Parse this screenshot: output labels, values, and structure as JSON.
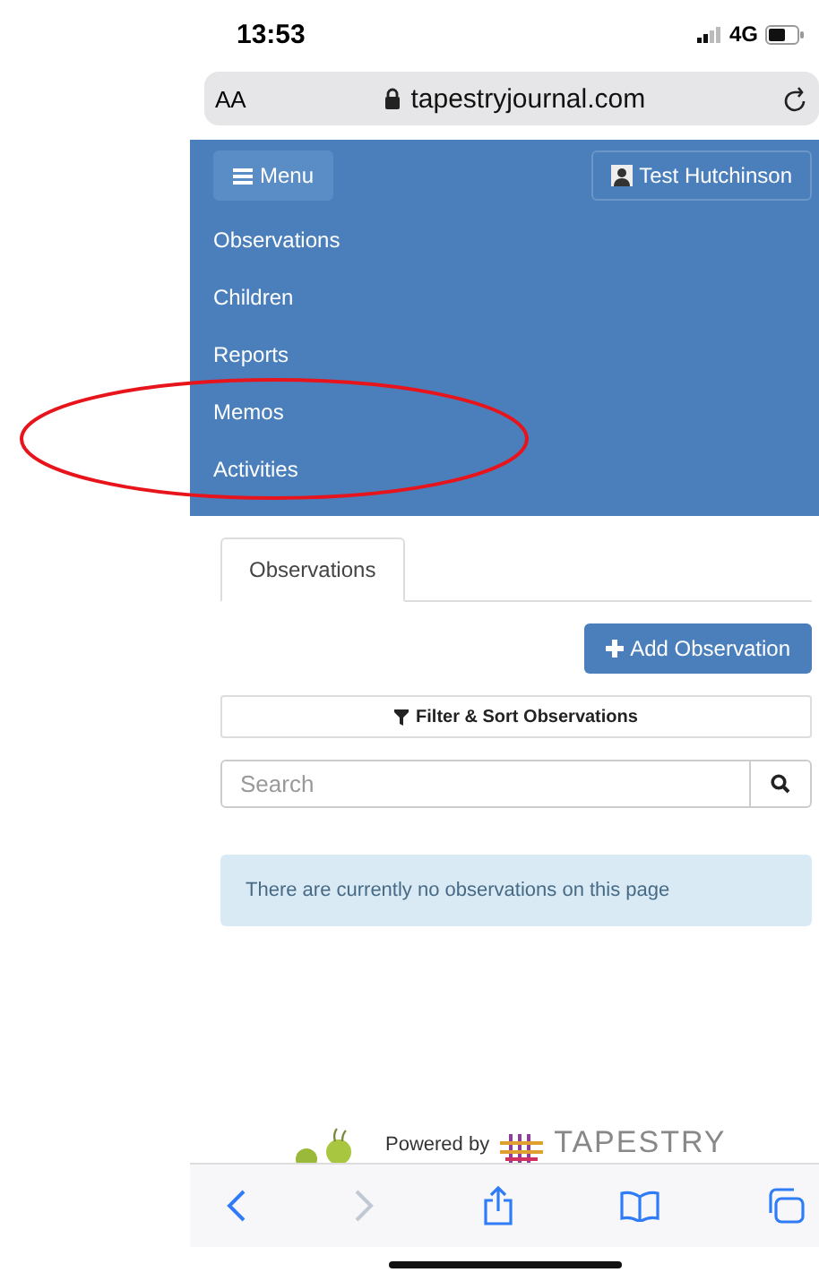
{
  "status_bar": {
    "time": "13:53",
    "network": "4G"
  },
  "address_bar": {
    "text_size": "AA",
    "url": "tapestryjournal.com"
  },
  "header": {
    "menu_button": "Menu",
    "user_button": "Test Hutchinson"
  },
  "menu": {
    "items": [
      {
        "label": "Observations"
      },
      {
        "label": "Children"
      },
      {
        "label": "Reports"
      },
      {
        "label": "Memos"
      },
      {
        "label": "Activities"
      }
    ]
  },
  "tabs": [
    {
      "label": "Observations",
      "selected": true
    }
  ],
  "add_button": "Add Observation",
  "filter_button": "Filter & Sort Observations",
  "search": {
    "placeholder": "Search"
  },
  "notice": "There are currently no observations on this page",
  "footer": {
    "powered_by": "Powered by",
    "brand": "TAPESTRY"
  }
}
